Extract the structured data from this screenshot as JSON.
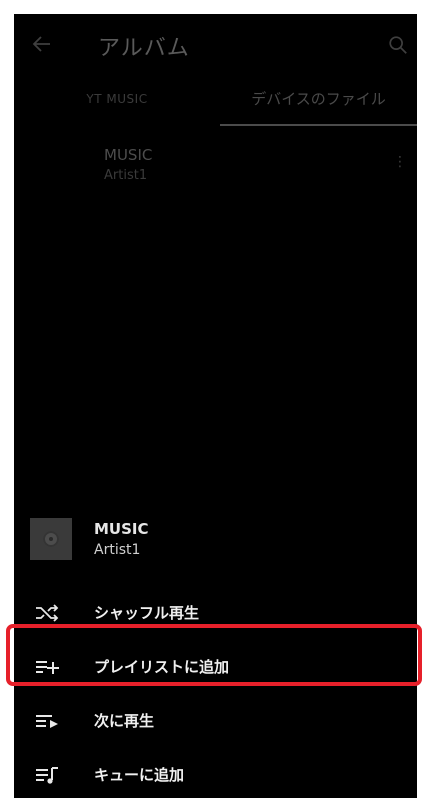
{
  "header": {
    "title": "アルバム"
  },
  "tabs": [
    {
      "label": "YT MUSIC"
    },
    {
      "label": "デバイスのファイル"
    }
  ],
  "track": {
    "title": "MUSIC",
    "artist": "Artist1"
  },
  "sheet": {
    "title": "MUSIC",
    "artist": "Artist1",
    "items": [
      {
        "label": "シャッフル再生",
        "icon": "shuffle-icon"
      },
      {
        "label": "プレイリストに追加",
        "icon": "playlist-add-icon"
      },
      {
        "label": "次に再生",
        "icon": "play-next-icon"
      },
      {
        "label": "キューに追加",
        "icon": "add-to-queue-icon"
      }
    ]
  },
  "colors": {
    "highlight": "#e6202a",
    "background": "#000000"
  }
}
